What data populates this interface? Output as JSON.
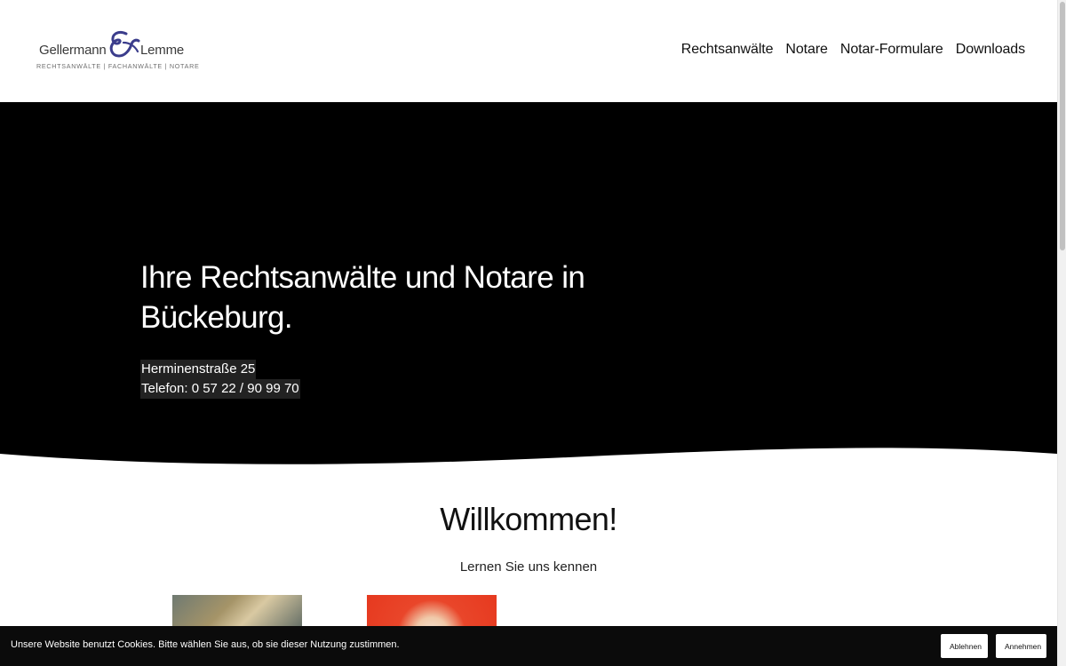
{
  "logo": {
    "name_left": "Gellermann",
    "name_right": "Lemme",
    "subtitle": "RECHTSANWÄLTE | FACHANWÄLTE | NOTARE",
    "accent_color": "#3b3d8c"
  },
  "nav": {
    "items": [
      {
        "label": "Rechtsanwälte"
      },
      {
        "label": "Notare"
      },
      {
        "label": "Notar-Formulare"
      },
      {
        "label": "Downloads"
      }
    ]
  },
  "hero": {
    "title": "Ihre Rechtsanwälte und Notare in Bückeburg.",
    "address_line1": "Herminenstraße 25",
    "address_line2": "Telefon: 0 57 22 / 90 99 70",
    "background_color": "#000000"
  },
  "welcome": {
    "title": "Willkommen!",
    "subtitle": "Lernen Sie uns kennen"
  },
  "cookie_bar": {
    "text": "Unsere Website benutzt Cookies. Bitte wählen Sie aus, ob sie dieser Nutzung zustimmen.",
    "decline_label": "Ablehnen",
    "accept_label": "Annehmen"
  }
}
